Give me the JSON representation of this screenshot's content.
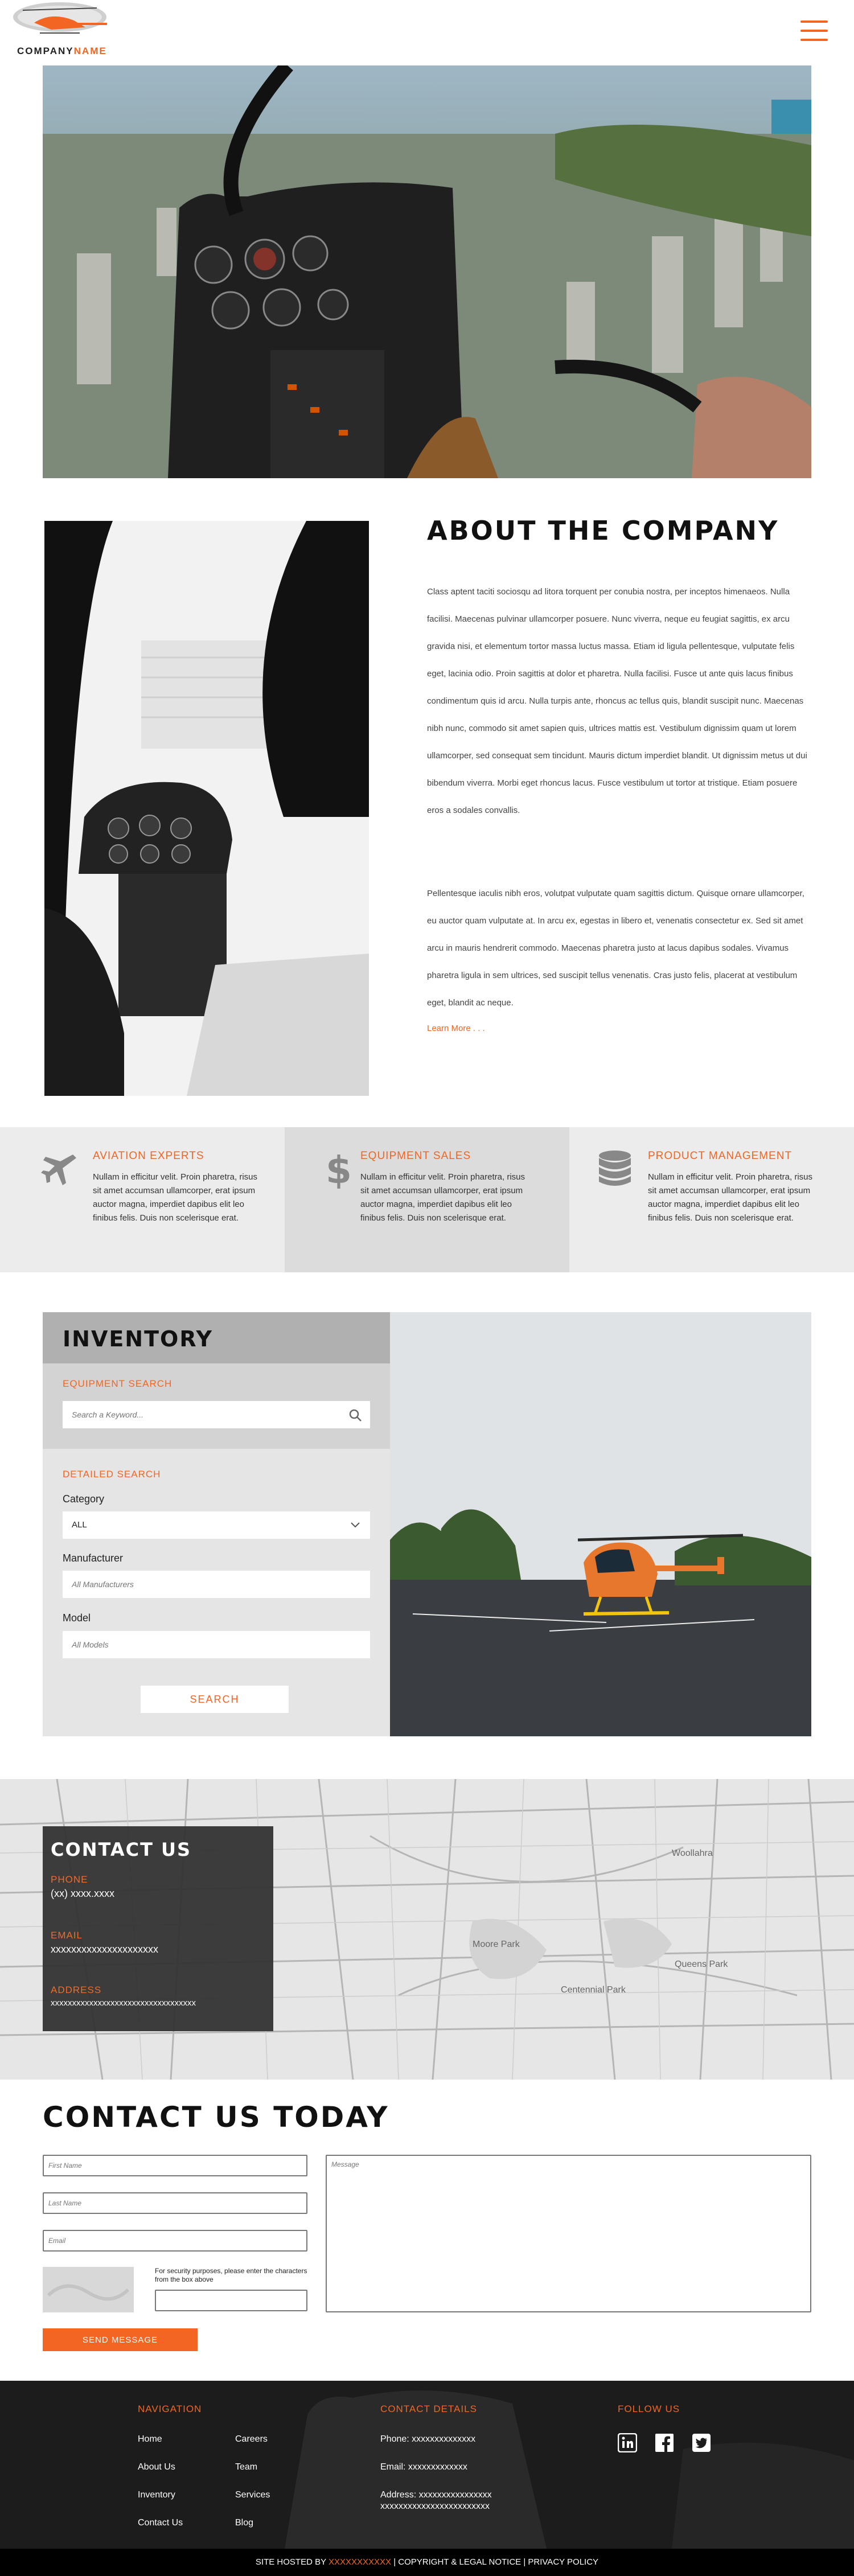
{
  "header": {
    "logo_word_a": "COMPANY",
    "logo_word_b": "NAME"
  },
  "about": {
    "title": "ABOUT THE COMPANY",
    "p1": "Class aptent taciti sociosqu ad litora torquent per conubia nostra, per inceptos himenaeos. Nulla facilisi. Maecenas pulvinar ullamcorper posuere. Nunc viverra, neque eu feugiat sagittis, ex arcu gravida nisi, et elementum tortor massa luctus massa. Etiam id ligula pellentesque, vulputate felis eget, lacinia odio. Proin sagittis at dolor et pharetra. Nulla facilisi. Fusce ut ante quis lacus finibus condimentum quis id arcu. Nulla turpis ante, rhoncus ac tellus quis, blandit suscipit nunc. Maecenas nibh nunc, commodo sit amet sapien quis, ultrices mattis est. Vestibulum dignissim quam ut lorem ullamcorper, sed consequat sem tincidunt. Mauris dictum imperdiet blandit. Ut dignissim metus ut dui bibendum viverra. Morbi eget rhoncus lacus. Fusce vestibulum ut tortor at tristique. Etiam posuere eros a sodales convallis.",
    "p2": "Pellentesque iaculis nibh eros, volutpat vulputate quam sagittis dictum. Quisque ornare ullamcorper, eu auctor quam vulputate at. In arcu ex, egestas in libero et, venenatis consectetur ex. Sed sit amet arcu in mauris hendrerit commodo. Maecenas pharetra justo at lacus dapibus sodales. Vivamus pharetra ligula in sem ultrices, sed suscipit tellus venenatis. Cras justo felis, placerat at vestibulum eget, blandit ac neque.",
    "learn_more": "Learn More . . ."
  },
  "features": [
    {
      "title": "AVIATION EXPERTS",
      "text": "Nullam in efficitur velit. Proin pharetra, risus sit amet accumsan ullamcorper, erat ipsum auctor magna, imperdiet dapibus elit leo finibus felis. Duis non scelerisque erat.",
      "icon": "airplane-icon"
    },
    {
      "title": "EQUIPMENT SALES",
      "text": "Nullam in efficitur velit. Proin pharetra, risus sit amet accumsan ullamcorper, erat ipsum auctor magna, imperdiet dapibus elit leo finibus felis. Duis non scelerisque erat.",
      "icon": "dollar-icon"
    },
    {
      "title": "PRODUCT MANAGEMENT",
      "text": "Nullam in efficitur velit. Proin pharetra, risus sit amet accumsan ullamcorper, erat ipsum auctor magna, imperdiet dapibus elit leo finibus felis. Duis non scelerisque erat.",
      "icon": "database-icon"
    }
  ],
  "inventory": {
    "title": "INVENTORY",
    "equipment_search_label": "EQUIPMENT SEARCH",
    "search_placeholder": "Search a Keyword...",
    "detailed_search_label": "DETAILED SEARCH",
    "category_label": "Category",
    "category_value": "ALL",
    "manufacturer_label": "Manufacturer",
    "manufacturer_placeholder": "All Manufacturers",
    "model_label": "Model",
    "model_placeholder": "All Models",
    "search_button": "SEARCH"
  },
  "contact_box": {
    "title": "CONTACT US",
    "phone_label": "PHONE",
    "phone_value": "(xx) xxxx.xxxx",
    "email_label": "EMAIL",
    "email_value": "xxxxxxxxxxxxxxxxxxxxx",
    "address_label": "ADDRESS",
    "address_value": "xxxxxxxxxxxxxxxxxxxxxxxxxxxxxxxxxx"
  },
  "map_labels": [
    "Moore Park",
    "Queens Park",
    "Centennial Park",
    "Woollahra"
  ],
  "contact_form": {
    "title": "CONTACT US TODAY",
    "first_name_placeholder": "First Name",
    "last_name_placeholder": "Last Name",
    "email_placeholder": "Email",
    "message_placeholder": "Message",
    "captcha_note": "For security purposes, please enter the characters from the box above",
    "send_button": "SEND MESSAGE"
  },
  "footer": {
    "navigation_head": "NAVIGATION",
    "nav_col1": [
      "Home",
      "About Us",
      "Inventory",
      "Contact Us"
    ],
    "nav_col2": [
      "Careers",
      "Team",
      "Services",
      "Blog"
    ],
    "contact_head": "CONTACT DETAILS",
    "phone": "Phone: xxxxxxxxxxxxxx",
    "email": "Email: xxxxxxxxxxxxx",
    "address_1": "Address: xxxxxxxxxxxxxxxx",
    "address_2": "xxxxxxxxxxxxxxxxxxxxxxxx",
    "follow_head": "FOLLOW US",
    "social": [
      "linkedin-icon",
      "facebook-icon",
      "twitter-icon"
    ]
  },
  "bottom_bar": {
    "hosted_by": "SITE HOSTED BY",
    "host_name": "XXXXXXXXXXX",
    "copyright": "| COPYRIGHT & LEGAL NOTICE | PRIVACY POLICY"
  },
  "colors": {
    "accent": "#f26522",
    "dark": "#333333",
    "footer_bg": "#1c1c1c"
  }
}
